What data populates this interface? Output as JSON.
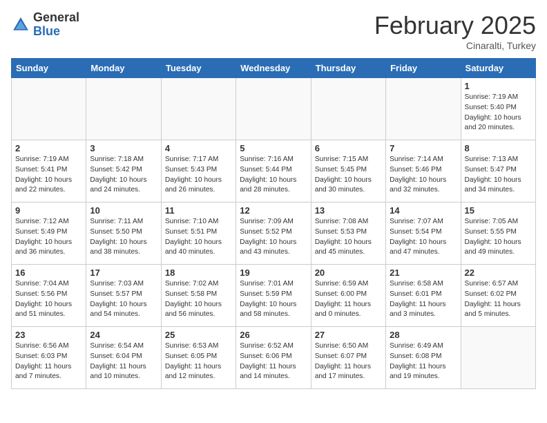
{
  "header": {
    "logo_general": "General",
    "logo_blue": "Blue",
    "month_title": "February 2025",
    "location": "Cinaralti, Turkey"
  },
  "days_of_week": [
    "Sunday",
    "Monday",
    "Tuesday",
    "Wednesday",
    "Thursday",
    "Friday",
    "Saturday"
  ],
  "weeks": [
    [
      {
        "day": "",
        "info": ""
      },
      {
        "day": "",
        "info": ""
      },
      {
        "day": "",
        "info": ""
      },
      {
        "day": "",
        "info": ""
      },
      {
        "day": "",
        "info": ""
      },
      {
        "day": "",
        "info": ""
      },
      {
        "day": "1",
        "info": "Sunrise: 7:19 AM\nSunset: 5:40 PM\nDaylight: 10 hours\nand 20 minutes."
      }
    ],
    [
      {
        "day": "2",
        "info": "Sunrise: 7:19 AM\nSunset: 5:41 PM\nDaylight: 10 hours\nand 22 minutes."
      },
      {
        "day": "3",
        "info": "Sunrise: 7:18 AM\nSunset: 5:42 PM\nDaylight: 10 hours\nand 24 minutes."
      },
      {
        "day": "4",
        "info": "Sunrise: 7:17 AM\nSunset: 5:43 PM\nDaylight: 10 hours\nand 26 minutes."
      },
      {
        "day": "5",
        "info": "Sunrise: 7:16 AM\nSunset: 5:44 PM\nDaylight: 10 hours\nand 28 minutes."
      },
      {
        "day": "6",
        "info": "Sunrise: 7:15 AM\nSunset: 5:45 PM\nDaylight: 10 hours\nand 30 minutes."
      },
      {
        "day": "7",
        "info": "Sunrise: 7:14 AM\nSunset: 5:46 PM\nDaylight: 10 hours\nand 32 minutes."
      },
      {
        "day": "8",
        "info": "Sunrise: 7:13 AM\nSunset: 5:47 PM\nDaylight: 10 hours\nand 34 minutes."
      }
    ],
    [
      {
        "day": "9",
        "info": "Sunrise: 7:12 AM\nSunset: 5:49 PM\nDaylight: 10 hours\nand 36 minutes."
      },
      {
        "day": "10",
        "info": "Sunrise: 7:11 AM\nSunset: 5:50 PM\nDaylight: 10 hours\nand 38 minutes."
      },
      {
        "day": "11",
        "info": "Sunrise: 7:10 AM\nSunset: 5:51 PM\nDaylight: 10 hours\nand 40 minutes."
      },
      {
        "day": "12",
        "info": "Sunrise: 7:09 AM\nSunset: 5:52 PM\nDaylight: 10 hours\nand 43 minutes."
      },
      {
        "day": "13",
        "info": "Sunrise: 7:08 AM\nSunset: 5:53 PM\nDaylight: 10 hours\nand 45 minutes."
      },
      {
        "day": "14",
        "info": "Sunrise: 7:07 AM\nSunset: 5:54 PM\nDaylight: 10 hours\nand 47 minutes."
      },
      {
        "day": "15",
        "info": "Sunrise: 7:05 AM\nSunset: 5:55 PM\nDaylight: 10 hours\nand 49 minutes."
      }
    ],
    [
      {
        "day": "16",
        "info": "Sunrise: 7:04 AM\nSunset: 5:56 PM\nDaylight: 10 hours\nand 51 minutes."
      },
      {
        "day": "17",
        "info": "Sunrise: 7:03 AM\nSunset: 5:57 PM\nDaylight: 10 hours\nand 54 minutes."
      },
      {
        "day": "18",
        "info": "Sunrise: 7:02 AM\nSunset: 5:58 PM\nDaylight: 10 hours\nand 56 minutes."
      },
      {
        "day": "19",
        "info": "Sunrise: 7:01 AM\nSunset: 5:59 PM\nDaylight: 10 hours\nand 58 minutes."
      },
      {
        "day": "20",
        "info": "Sunrise: 6:59 AM\nSunset: 6:00 PM\nDaylight: 11 hours\nand 0 minutes."
      },
      {
        "day": "21",
        "info": "Sunrise: 6:58 AM\nSunset: 6:01 PM\nDaylight: 11 hours\nand 3 minutes."
      },
      {
        "day": "22",
        "info": "Sunrise: 6:57 AM\nSunset: 6:02 PM\nDaylight: 11 hours\nand 5 minutes."
      }
    ],
    [
      {
        "day": "23",
        "info": "Sunrise: 6:56 AM\nSunset: 6:03 PM\nDaylight: 11 hours\nand 7 minutes."
      },
      {
        "day": "24",
        "info": "Sunrise: 6:54 AM\nSunset: 6:04 PM\nDaylight: 11 hours\nand 10 minutes."
      },
      {
        "day": "25",
        "info": "Sunrise: 6:53 AM\nSunset: 6:05 PM\nDaylight: 11 hours\nand 12 minutes."
      },
      {
        "day": "26",
        "info": "Sunrise: 6:52 AM\nSunset: 6:06 PM\nDaylight: 11 hours\nand 14 minutes."
      },
      {
        "day": "27",
        "info": "Sunrise: 6:50 AM\nSunset: 6:07 PM\nDaylight: 11 hours\nand 17 minutes."
      },
      {
        "day": "28",
        "info": "Sunrise: 6:49 AM\nSunset: 6:08 PM\nDaylight: 11 hours\nand 19 minutes."
      },
      {
        "day": "",
        "info": ""
      }
    ]
  ]
}
